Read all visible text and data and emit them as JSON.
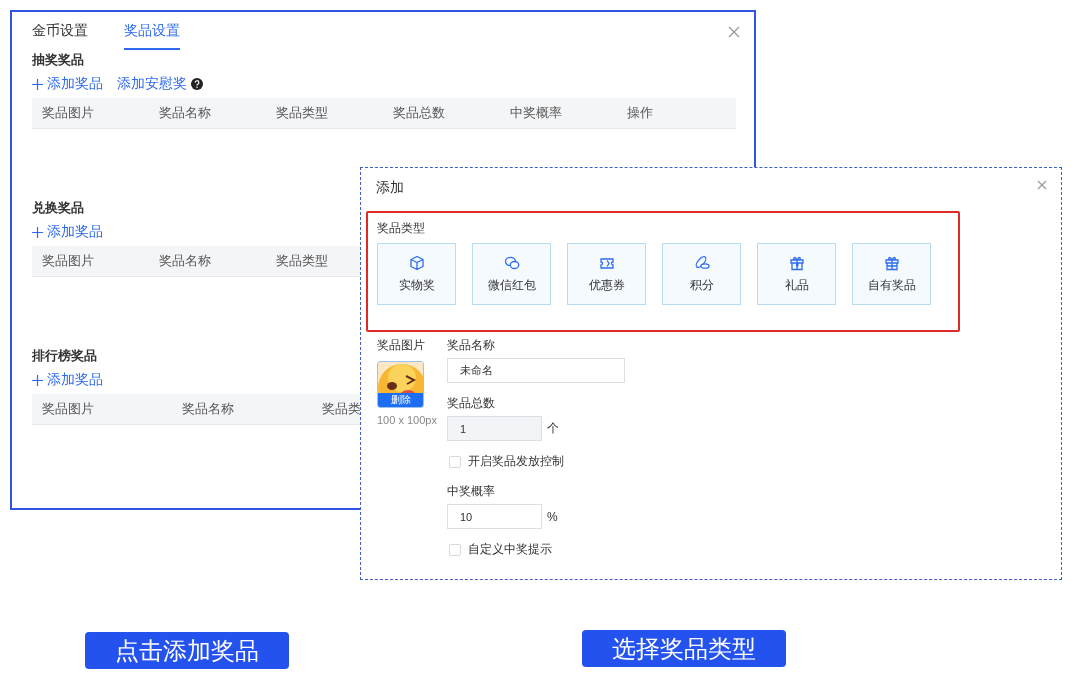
{
  "settings_panel": {
    "tabs": [
      {
        "label": "金币设置",
        "selected": false
      },
      {
        "label": "奖品设置",
        "selected": true
      }
    ],
    "sections": [
      {
        "title": "抽奖奖品",
        "actions": [
          {
            "label": "添加奖品",
            "kind": "add"
          },
          {
            "label": "添加安慰奖",
            "kind": "help"
          }
        ],
        "columns": [
          "奖品图片",
          "奖品名称",
          "奖品类型",
          "奖品总数",
          "中奖概率",
          "操作"
        ]
      },
      {
        "title": "兑换奖品",
        "actions": [
          {
            "label": "添加奖品",
            "kind": "add"
          }
        ],
        "columns": [
          "奖品图片",
          "奖品名称",
          "奖品类型"
        ]
      },
      {
        "title": "排行榜奖品",
        "actions": [
          {
            "label": "添加奖品",
            "kind": "add"
          }
        ],
        "columns": [
          "奖品图片",
          "奖品名称",
          "奖品类"
        ]
      }
    ]
  },
  "add_dialog": {
    "title": "添加",
    "prize_type": {
      "label": "奖品类型",
      "options": [
        {
          "label": "实物奖"
        },
        {
          "label": "微信红包"
        },
        {
          "label": "优惠券"
        },
        {
          "label": "积分"
        },
        {
          "label": "礼品"
        },
        {
          "label": "自有奖品"
        }
      ]
    },
    "image": {
      "label": "奖品图片",
      "delete_label": "删除",
      "hint": "100 x 100px"
    },
    "fields": [
      {
        "kind": "text",
        "label": "奖品名称",
        "value": "未命名"
      },
      {
        "kind": "number",
        "label": "奖品总数",
        "value": "1",
        "unit": "个",
        "disabled": true
      },
      {
        "kind": "checkbox",
        "label": "开启奖品发放控制",
        "checked": false
      },
      {
        "kind": "number",
        "label": "中奖概率",
        "value": "10",
        "unit": "%",
        "disabled": false
      },
      {
        "kind": "checkbox",
        "label": "自定义中奖提示",
        "checked": false
      }
    ]
  },
  "captions": [
    "点击添加奖品",
    "选择奖品类型"
  ]
}
